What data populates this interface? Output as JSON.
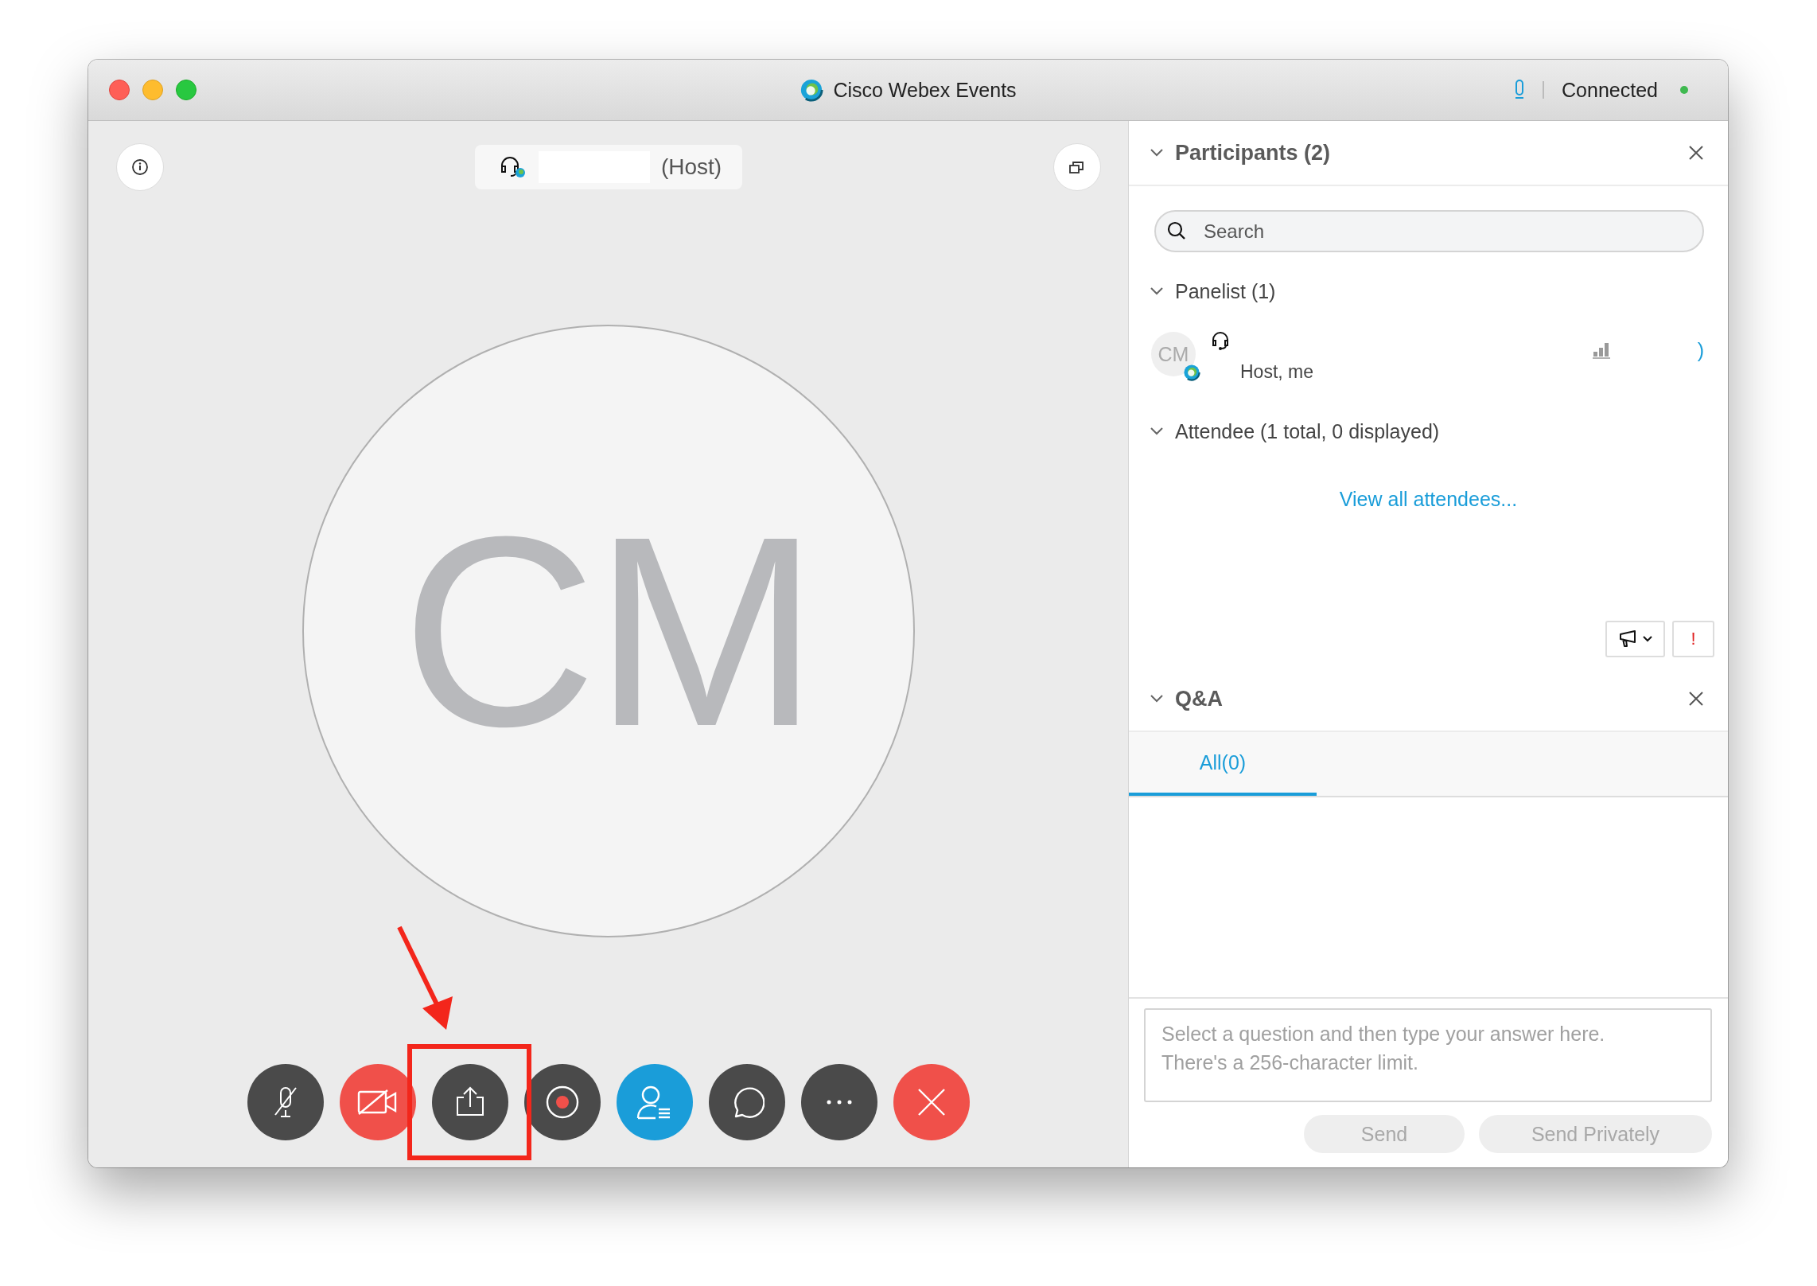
{
  "window": {
    "title": "Cisco Webex Events",
    "connection_status": "Connected"
  },
  "stage": {
    "presenter_role": "(Host)",
    "avatar_initials": "CM"
  },
  "toolbar": [
    {
      "kind": "mute"
    },
    {
      "kind": "video"
    },
    {
      "kind": "share"
    },
    {
      "kind": "record"
    },
    {
      "kind": "participants"
    },
    {
      "kind": "chat"
    },
    {
      "kind": "more"
    },
    {
      "kind": "leave"
    }
  ],
  "participants": {
    "title": "Participants (2)",
    "expanded": true,
    "search": {
      "placeholder": "Search"
    },
    "groups": [
      {
        "label": "Panelist (1)",
        "expanded": true,
        "members": [
          {
            "initials": "CM",
            "role": "Host, me",
            "status_mark": ")"
          }
        ]
      },
      {
        "label": "Attendee (1 total, 0 displayed)",
        "expanded": true
      }
    ],
    "link": "View all attendees...",
    "alert_label": "!"
  },
  "qa": {
    "title": "Q&A",
    "expanded": true,
    "tabs": [
      {
        "label": "All(0)",
        "selected": true
      }
    ],
    "answer": {
      "placeholder": "Select a question and then type your answer here. There's a 256-character limit."
    },
    "buttons": [
      "Send",
      "Send Privately"
    ]
  }
}
